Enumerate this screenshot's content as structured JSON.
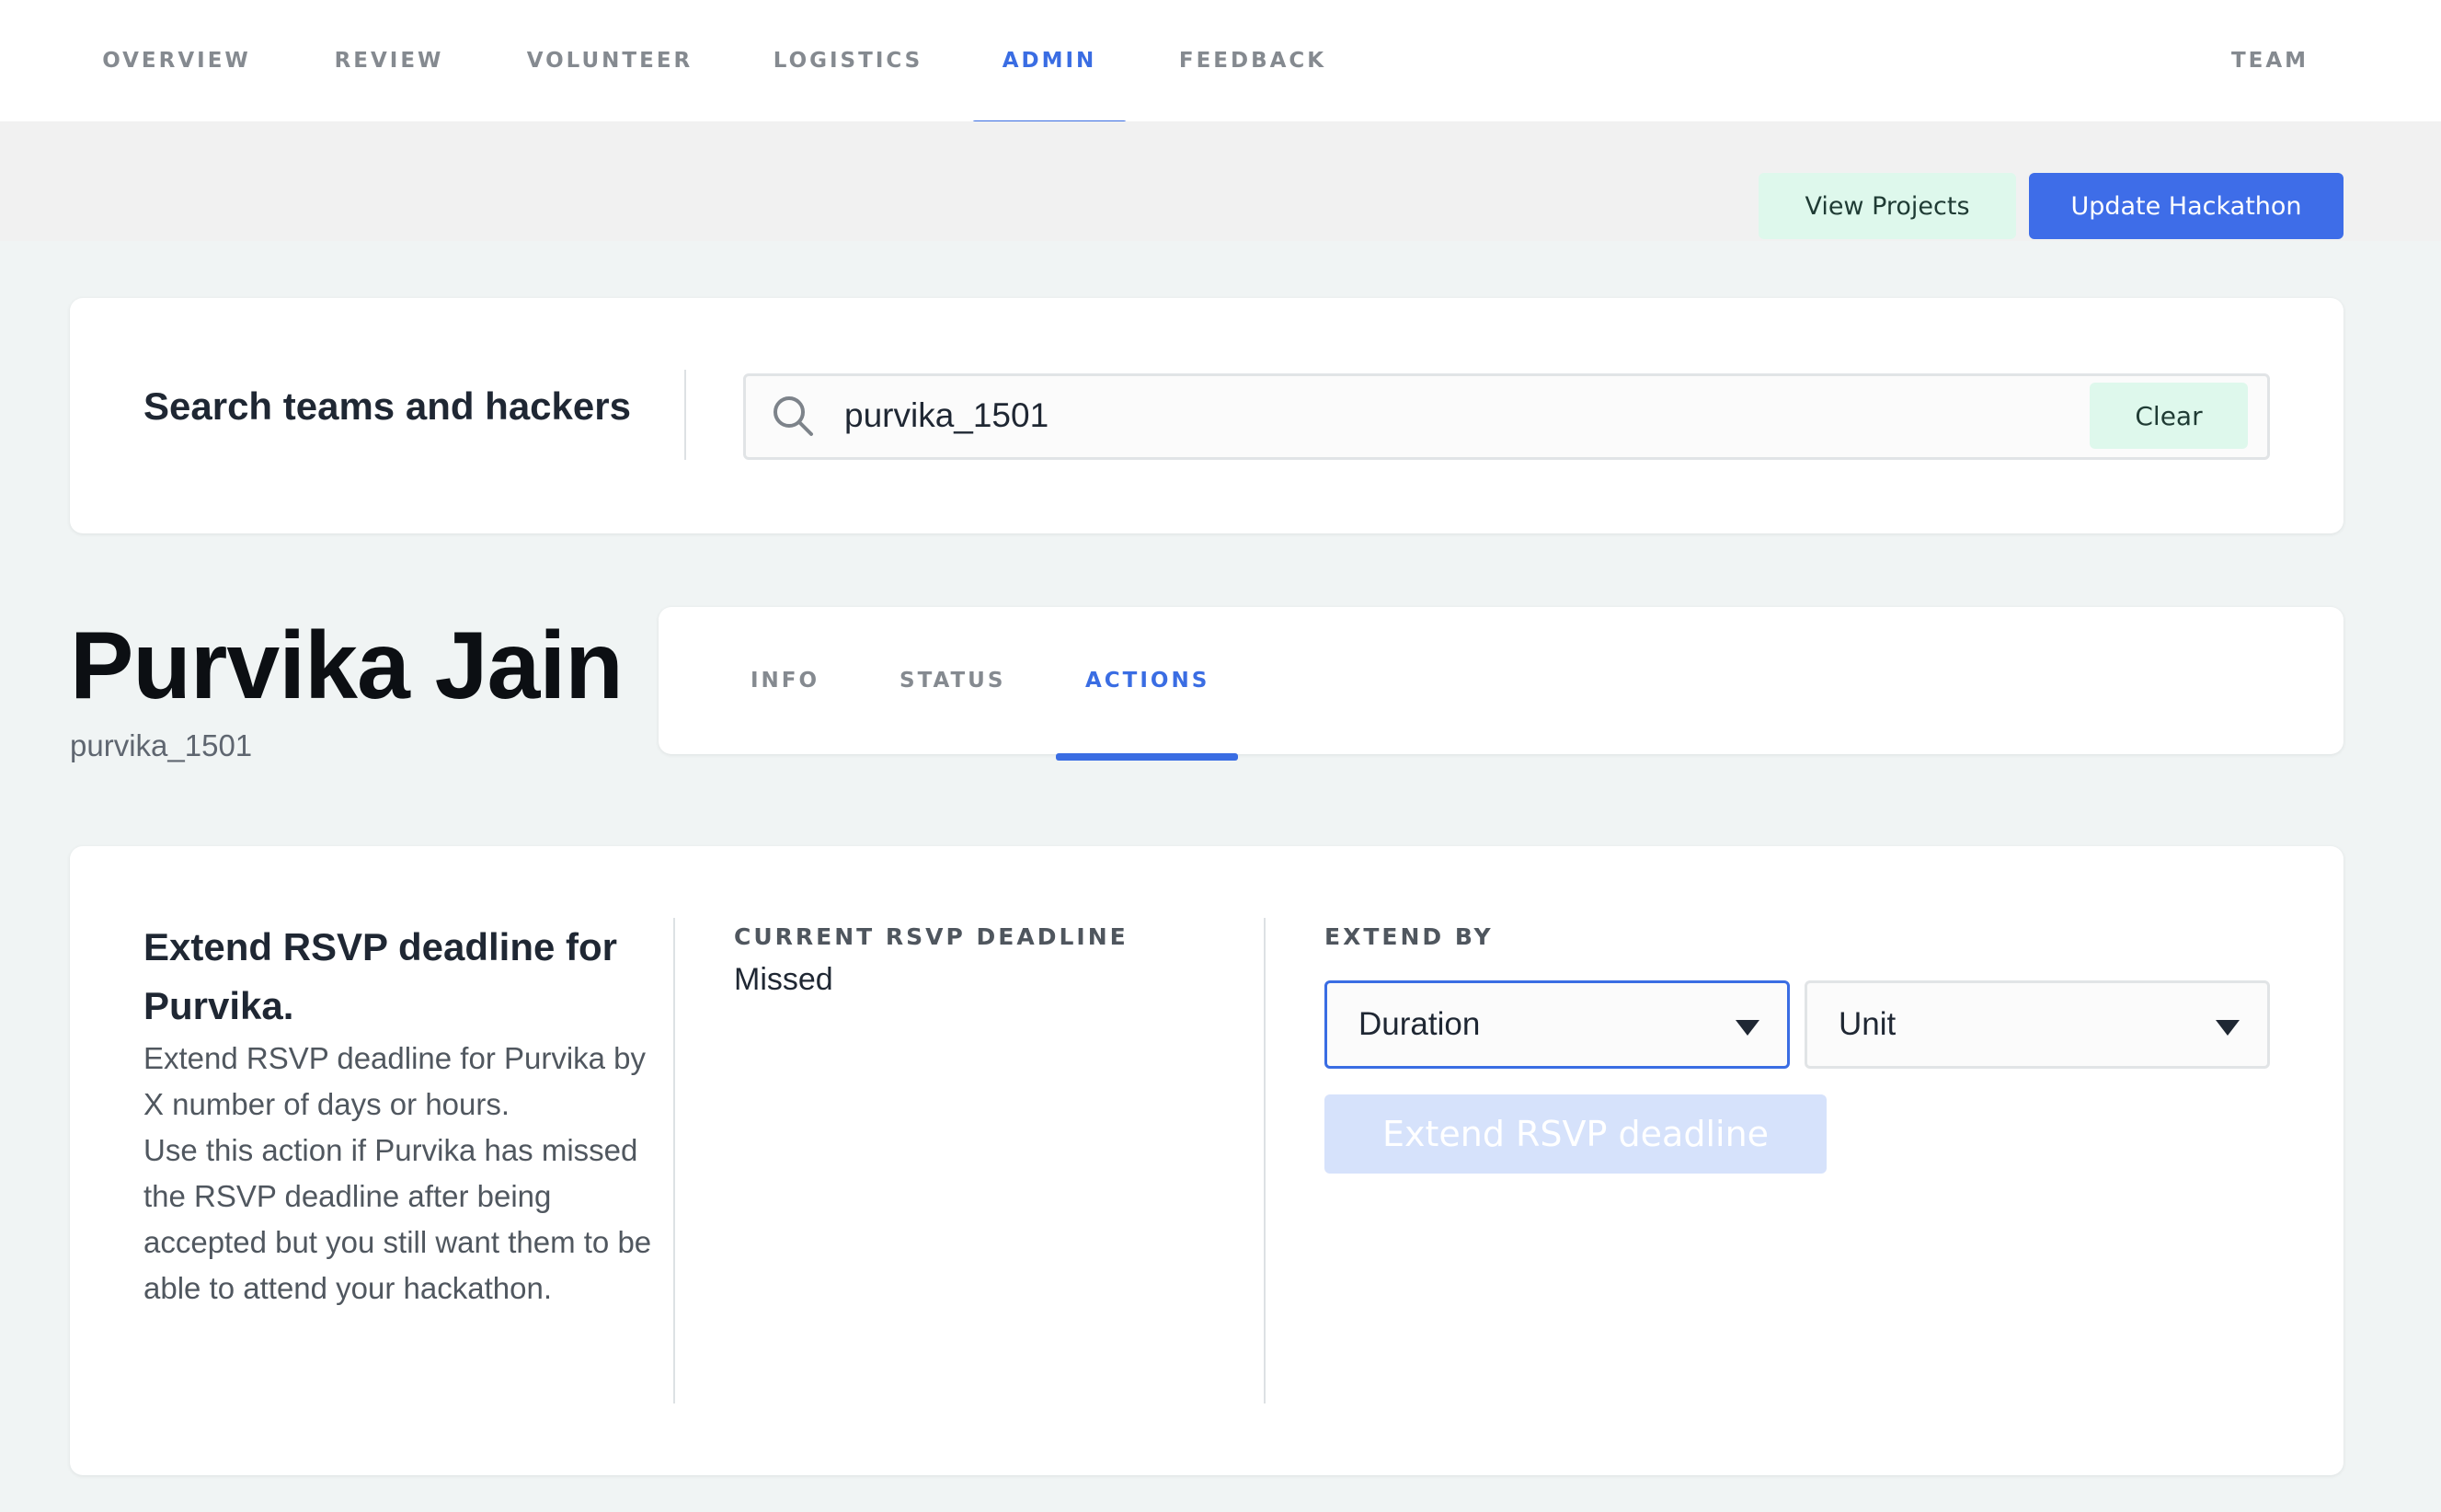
{
  "nav": {
    "items": [
      "OVERVIEW",
      "REVIEW",
      "VOLUNTEER",
      "LOGISTICS",
      "ADMIN",
      "FEEDBACK"
    ],
    "active": "ADMIN",
    "right_item": "TEAM"
  },
  "header_actions": {
    "view_projects_label": "View Projects",
    "update_hackathon_label": "Update Hackathon"
  },
  "search": {
    "title": "Search teams and hackers",
    "value": "purvika_1501",
    "clear_label": "Clear",
    "icon": "search-icon"
  },
  "profile": {
    "name": "Purvika Jain",
    "username": "purvika_1501",
    "tabs": [
      "INFO",
      "STATUS",
      "ACTIONS"
    ],
    "active_tab": "ACTIONS"
  },
  "action": {
    "title": "Extend RSVP deadline for Purvika.",
    "description_1": "Extend RSVP deadline for Purvika by X number of days or hours.",
    "description_2": "Use this action if Purvika has missed the RSVP deadline after being accepted but you still want them to be able to attend your hackathon.",
    "current_deadline_label": "CURRENT RSVP DEADLINE",
    "current_deadline_value": "Missed",
    "extend_by_label": "EXTEND BY",
    "duration_value": "Duration",
    "unit_value": "Unit",
    "submit_label": "Extend RSVP deadline"
  },
  "colors": {
    "accent": "#3a6de3",
    "mint": "#def8ec",
    "disabled_button": "#d6e2fb",
    "page_background": "#f0f4f4"
  }
}
